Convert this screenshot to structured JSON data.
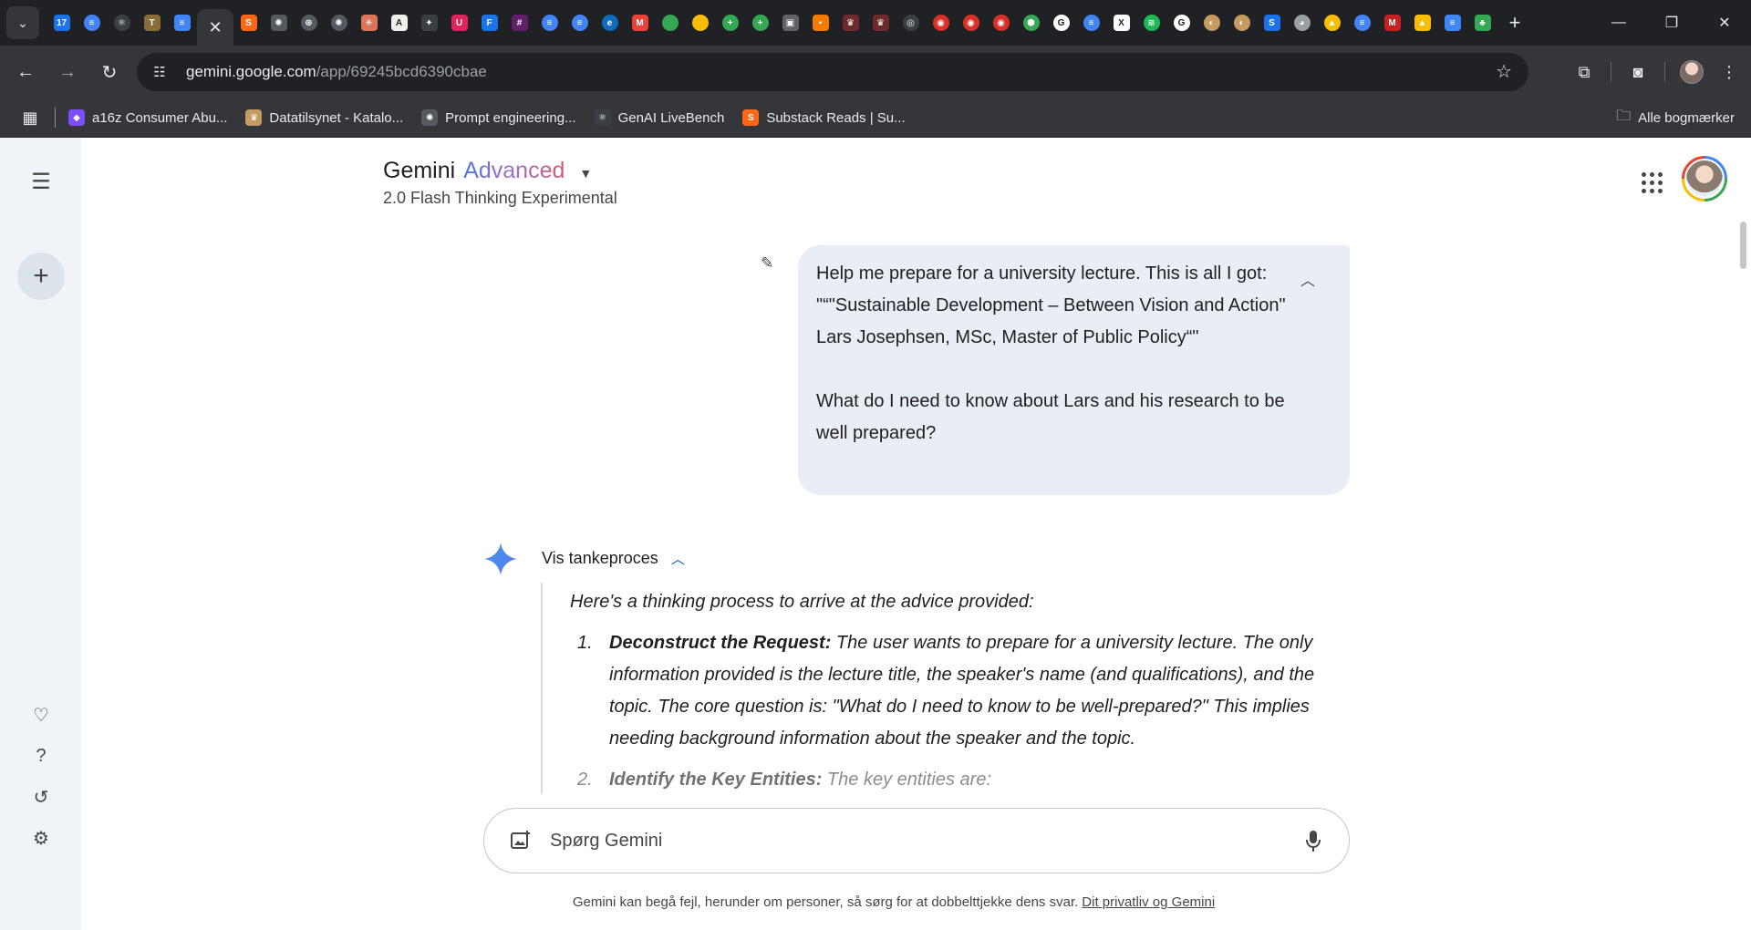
{
  "browser": {
    "tab_icons": [
      {
        "name": "calendar-tab-icon",
        "color": "#1a73e8",
        "glyph": "17",
        "round": false
      },
      {
        "name": "docs-tab-icon",
        "color": "#4285f4",
        "glyph": "≡",
        "round": true
      },
      {
        "name": "react-tab-icon",
        "color": "#3b3f45",
        "glyph": "⚛",
        "round": true
      },
      {
        "name": "tool-tab-icon",
        "color": "#8b6d3a",
        "glyph": "T",
        "round": false
      },
      {
        "name": "docs-tab-icon",
        "color": "#4285f4",
        "glyph": "≡",
        "round": false
      },
      {
        "name": "substack-tab-icon",
        "color": "#ff6719",
        "glyph": "S",
        "round": false
      },
      {
        "name": "openai-tab-icon",
        "color": "#555a60",
        "glyph": "✺",
        "round": false
      },
      {
        "name": "perplexity-tab-icon",
        "color": "#555a60",
        "glyph": "⊛",
        "round": true
      },
      {
        "name": "openai-tab-icon",
        "color": "#555a60",
        "glyph": "✺",
        "round": true
      },
      {
        "name": "claude-tab-icon",
        "color": "#d97757",
        "glyph": "✳",
        "round": false
      },
      {
        "name": "anthropic-tab-icon",
        "color": "#f0efe9",
        "glyph": "A",
        "round": false
      },
      {
        "name": "star-tab-icon",
        "color": "#3b3f45",
        "glyph": "✦",
        "round": false
      },
      {
        "name": "u-tab-icon",
        "color": "#e0245e",
        "glyph": "U",
        "round": false
      },
      {
        "name": "forms-tab-icon",
        "color": "#1a73e8",
        "glyph": "F",
        "round": false
      },
      {
        "name": "slack-tab-icon",
        "color": "#611f69",
        "glyph": "#",
        "round": false
      },
      {
        "name": "docs-tab-icon",
        "color": "#4285f4",
        "glyph": "≡",
        "round": true
      },
      {
        "name": "docs-tab-icon",
        "color": "#4285f4",
        "glyph": "≡",
        "round": true
      },
      {
        "name": "edge-tab-icon",
        "color": "#0f6cbd",
        "glyph": "e",
        "round": true
      },
      {
        "name": "gmail-tab-icon",
        "color": "#ea4335",
        "glyph": "M",
        "round": false
      },
      {
        "name": "green-tab-icon",
        "color": "#34a853",
        "glyph": "",
        "round": true
      },
      {
        "name": "keep-tab-icon",
        "color": "#fbbc04",
        "glyph": "",
        "round": true
      },
      {
        "name": "plus-green-tab-icon",
        "color": "#34a853",
        "glyph": "+",
        "round": true
      },
      {
        "name": "plus-green-tab-icon",
        "color": "#34a853",
        "glyph": "+",
        "round": true
      },
      {
        "name": "car-tab-icon",
        "color": "#5f6368",
        "glyph": "▣",
        "round": false
      },
      {
        "name": "hf-tab-icon",
        "color": "#f57c00",
        "glyph": "▪",
        "round": false
      },
      {
        "name": "crown-tab-icon",
        "color": "#6e2a2a",
        "glyph": "♛",
        "round": false
      },
      {
        "name": "crown-tab-icon",
        "color": "#6e2a2a",
        "glyph": "♛",
        "round": false
      },
      {
        "name": "circle-tab-icon",
        "color": "#3b3f45",
        "glyph": "◎",
        "round": true
      },
      {
        "name": "red-tab-icon",
        "color": "#d93025",
        "glyph": "◉",
        "round": true
      },
      {
        "name": "red-tab-icon",
        "color": "#d93025",
        "glyph": "◉",
        "round": true
      },
      {
        "name": "red-tab-icon",
        "color": "#d93025",
        "glyph": "◉",
        "round": true
      },
      {
        "name": "shield-tab-icon",
        "color": "#34a853",
        "glyph": "⬢",
        "round": true
      },
      {
        "name": "google-tab-icon",
        "color": "#ffffff",
        "glyph": "G",
        "round": true
      },
      {
        "name": "docs-tab-icon",
        "color": "#4285f4",
        "glyph": "≡",
        "round": true
      },
      {
        "name": "x-tab-icon",
        "color": "#ffffff",
        "glyph": "X",
        "round": false
      },
      {
        "name": "spotify-tab-icon",
        "color": "#1db954",
        "glyph": "≋",
        "round": true
      },
      {
        "name": "google-tab-icon",
        "color": "#ffffff",
        "glyph": "G",
        "round": true
      },
      {
        "name": "spiral-tab-icon",
        "color": "#c59b5f",
        "glyph": "◐",
        "round": true
      },
      {
        "name": "spiral-tab-icon",
        "color": "#c59b5f",
        "glyph": "◐",
        "round": true
      },
      {
        "name": "s-tab-icon",
        "color": "#1a73e8",
        "glyph": "S",
        "round": false
      },
      {
        "name": "globe-tab-icon",
        "color": "#9aa0a6",
        "glyph": "◕",
        "round": true
      },
      {
        "name": "drive-tab-icon",
        "color": "#fbbc04",
        "glyph": "▲",
        "round": true
      },
      {
        "name": "docs-tab-icon",
        "color": "#4285f4",
        "glyph": "≡",
        "round": true
      },
      {
        "name": "m-tab-icon",
        "color": "#c5221f",
        "glyph": "M",
        "round": false
      },
      {
        "name": "drive-tab-icon",
        "color": "#fbbc04",
        "glyph": "▲",
        "round": false
      },
      {
        "name": "docs-tab-icon",
        "color": "#4285f4",
        "glyph": "≡",
        "round": false
      },
      {
        "name": "tree-tab-icon",
        "color": "#34a853",
        "glyph": "♣",
        "round": false
      }
    ],
    "url_host": "gemini.google.com",
    "url_path": "/app/69245bcd6390cbae",
    "bookmarks": [
      {
        "label": "a16z Consumer Abu...",
        "icon": "a16z-icon",
        "color": "#7c4dff",
        "glyph": "◆"
      },
      {
        "label": "Datatilsynet - Katalo...",
        "icon": "crown-icon",
        "color": "#c59b5f",
        "glyph": "♛"
      },
      {
        "label": "Prompt engineering...",
        "icon": "openai-icon",
        "color": "#555a60",
        "glyph": "✺"
      },
      {
        "label": "GenAI LiveBench",
        "icon": "react-icon",
        "color": "#3b3f45",
        "glyph": "⚛"
      },
      {
        "label": "Substack Reads | Su...",
        "icon": "substack-icon",
        "color": "#ff6719",
        "glyph": "S"
      }
    ],
    "all_bookmarks_label": "Alle bogmærker"
  },
  "gemini": {
    "title": "Gemini",
    "title_accent": "Advanced",
    "model": "2.0 Flash Thinking Experimental",
    "user_message": "Help me prepare for a university lecture. This is all I got: \"“\"Sustainable Development – Between Vision and Action\"\nLars Josephsen, MSc, Master of Public Policy“\"\n\nWhat do I need to know about Lars and his research to be well prepared?",
    "thinking_toggle_label": "Vis tankeproces",
    "thinking": {
      "intro": "Here's a thinking process to arrive at the advice provided:",
      "steps": [
        {
          "num": "1.",
          "title": "Deconstruct the Request:",
          "text": " The user wants to prepare for a university lecture.  The only information provided is the lecture title, the speaker's name (and qualifications), and the topic.  The core question is: \"What do I need to know to be well-prepared?\"  This implies needing background information about the speaker and the topic."
        },
        {
          "num": "2.",
          "title": "Identify the Key Entities:",
          "text": "  The key entities are:"
        }
      ]
    },
    "input_placeholder": "Spørg Gemini",
    "disclaimer": "Gemini kan begå fejl, herunder om personer, så sørg for at dobbelttjekke dens svar.",
    "disclaimer_link": "Dit privatliv og Gemini"
  }
}
